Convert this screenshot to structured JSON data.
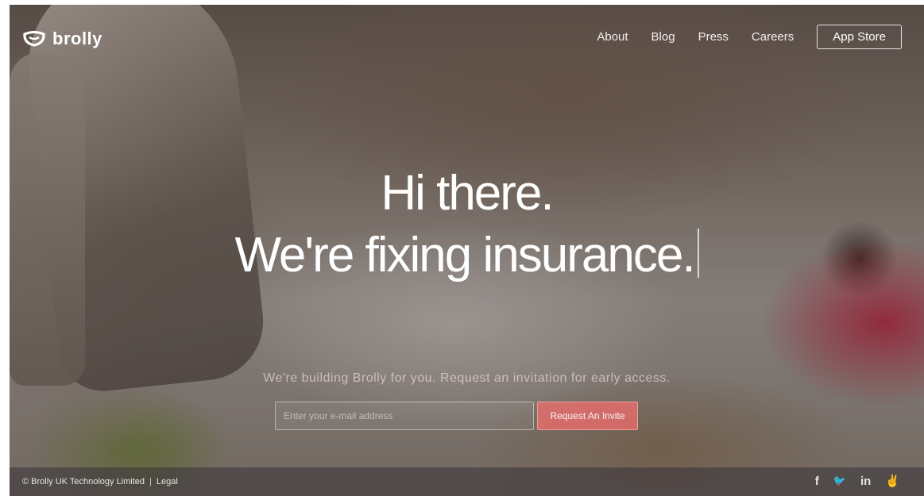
{
  "brand": {
    "name": "brolly"
  },
  "nav": {
    "links": [
      "About",
      "Blog",
      "Press",
      "Careers"
    ],
    "cta": "App Store"
  },
  "hero": {
    "line1": "Hi there.",
    "line2": "We're fixing insurance."
  },
  "signup": {
    "tagline": "We're building Brolly for you. Request an invitation for early access.",
    "email_placeholder": "Enter your e-mail address",
    "button": "Request An Invite"
  },
  "footer": {
    "copyright": "© Brolly UK Technology Limited",
    "separator": "|",
    "legal": "Legal",
    "social": [
      {
        "icon": "facebook-icon",
        "glyph": "f"
      },
      {
        "icon": "twitter-icon",
        "glyph": "🐦"
      },
      {
        "icon": "linkedin-icon",
        "glyph": "in"
      },
      {
        "icon": "angellist-icon",
        "glyph": "✌"
      }
    ]
  },
  "colors": {
    "accent": "#f06e6e",
    "text": "#ffffff"
  }
}
